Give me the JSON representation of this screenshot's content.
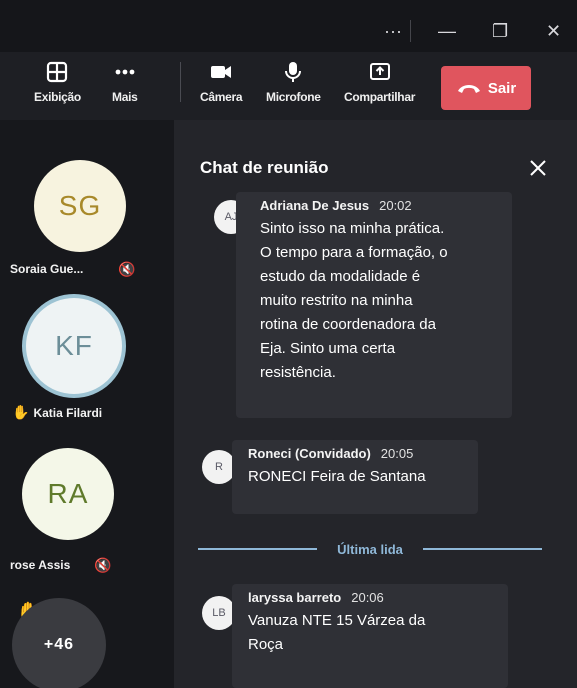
{
  "titlebar": {
    "more_glyph": "···",
    "minimize_glyph": "—",
    "restore_glyph": "❐",
    "close_glyph": "✕"
  },
  "toolbar": {
    "view_label": "Exibição",
    "more_label": "Mais",
    "camera_label": "Câmera",
    "mic_label": "Microfone",
    "share_label": "Compartilhar",
    "leave_label": "Sair",
    "leave_color": "#e0555e"
  },
  "participants": [
    {
      "initials": "SG",
      "name": "Soraia Gue...",
      "muted": true
    },
    {
      "initials": "KF",
      "name": "Katia Filardi",
      "hand_raised": true
    },
    {
      "initials": "RA",
      "name": "rose Assis",
      "muted": true
    },
    {
      "overflow": "+46",
      "hand_raised": true
    }
  ],
  "chat": {
    "title": "Chat de reunião",
    "messages": [
      {
        "initials": "AJ",
        "author": "Adriana De Jesus",
        "time": "20:02",
        "lines": [
          "Sinto isso na minha prática.",
          "O tempo para a formação, o",
          "estudo da modalidade é",
          "muito restrito na minha",
          "rotina de coordenadora da",
          "Eja. Sinto uma certa",
          "resistência."
        ]
      },
      {
        "initials": "R",
        "author": "Roneci (Convidado)",
        "time": "20:05",
        "lines": [
          "RONECI Feira de Santana"
        ]
      },
      {
        "initials": "LB",
        "author": "laryssa barreto",
        "time": "20:06",
        "lines": [
          "Vanuza NTE 15 Várzea da",
          "Roça"
        ]
      }
    ],
    "last_read_label": "Última lida"
  },
  "colors": {
    "accent": "#8fb8d8",
    "leave": "#e0555e",
    "raised_hand": "#f2c233"
  }
}
